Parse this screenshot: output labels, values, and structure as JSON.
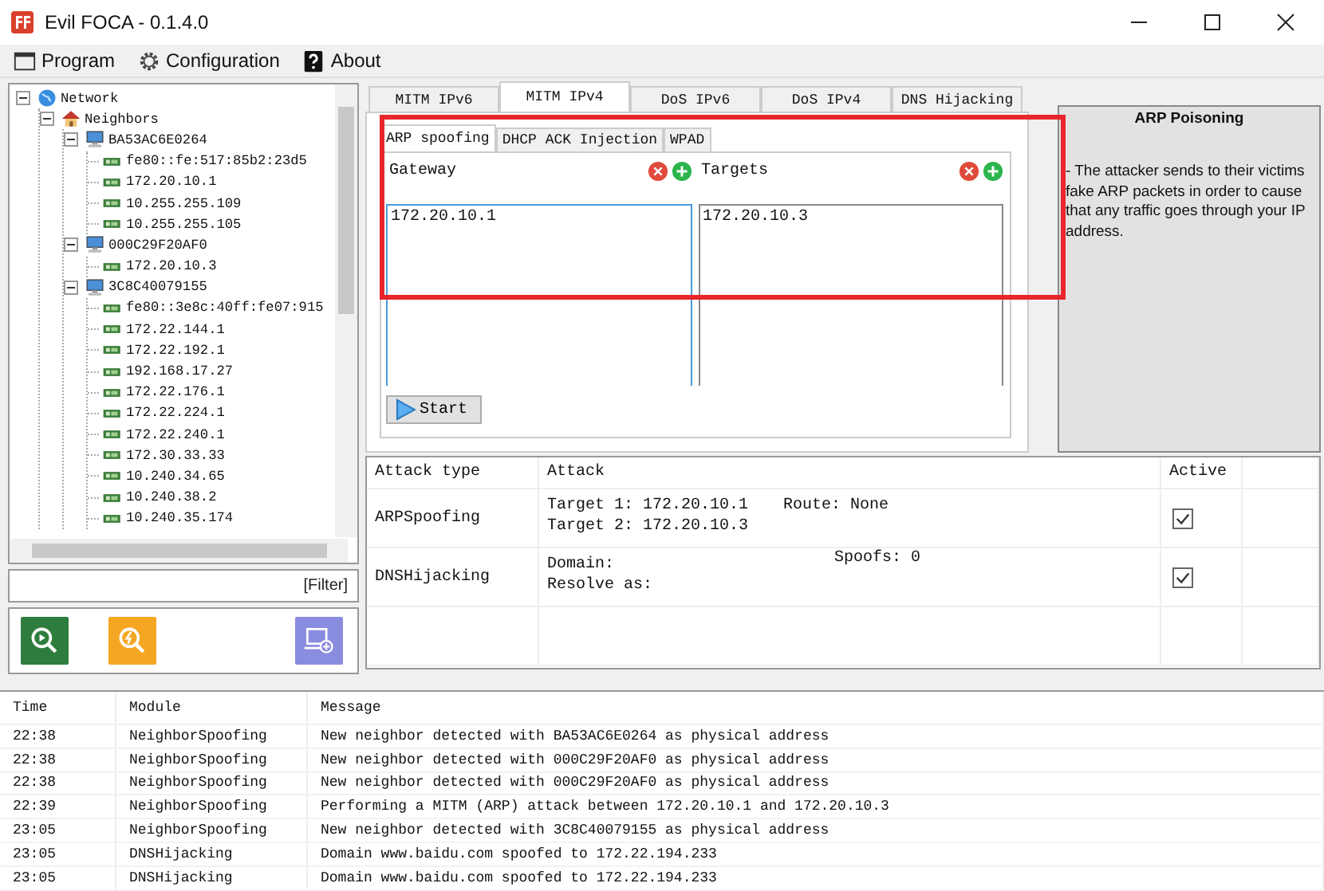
{
  "window": {
    "title": "Evil FOCA - 0.1.4.0"
  },
  "menu": [
    {
      "label": "Program",
      "kind": "window"
    },
    {
      "label": "Configuration",
      "kind": "gear"
    },
    {
      "label": "About",
      "kind": "help"
    }
  ],
  "tree": [
    {
      "label": "Network",
      "kind": "globe",
      "expanded": true,
      "children": [
        {
          "label": "Neighbors",
          "kind": "house",
          "expanded": true,
          "children": [
            {
              "label": "BA53AC6E0264",
              "kind": "computer",
              "expanded": true,
              "children": [
                {
                  "label": "fe80::fe:517:85b2:23d5",
                  "kind": "nic"
                },
                {
                  "label": "172.20.10.1",
                  "kind": "nic"
                },
                {
                  "label": "10.255.255.109",
                  "kind": "nic"
                },
                {
                  "label": "10.255.255.105",
                  "kind": "nic"
                }
              ]
            },
            {
              "label": "000C29F20AF0",
              "kind": "computer",
              "expanded": true,
              "children": [
                {
                  "label": "172.20.10.3",
                  "kind": "nic"
                }
              ]
            },
            {
              "label": "3C8C40079155",
              "kind": "computer",
              "expanded": true,
              "children": [
                {
                  "label": "fe80::3e8c:40ff:fe07:915",
                  "kind": "nic"
                },
                {
                  "label": "172.22.144.1",
                  "kind": "nic"
                },
                {
                  "label": "172.22.192.1",
                  "kind": "nic"
                },
                {
                  "label": "192.168.17.27",
                  "kind": "nic"
                },
                {
                  "label": "172.22.176.1",
                  "kind": "nic"
                },
                {
                  "label": "172.22.224.1",
                  "kind": "nic"
                },
                {
                  "label": "172.22.240.1",
                  "kind": "nic"
                },
                {
                  "label": "172.30.33.33",
                  "kind": "nic"
                },
                {
                  "label": "10.240.34.65",
                  "kind": "nic"
                },
                {
                  "label": "10.240.38.2",
                  "kind": "nic"
                },
                {
                  "label": "10.240.35.174",
                  "kind": "nic"
                }
              ]
            }
          ]
        }
      ]
    }
  ],
  "filter": "[Filter]",
  "tool_buttons": [
    {
      "kind": "scan"
    },
    {
      "kind": "attack-scan"
    },
    {
      "kind": "add-computer"
    }
  ],
  "tabs": [
    {
      "label": "MITM IPv6",
      "selected": false
    },
    {
      "label": "MITM IPv4",
      "selected": true
    },
    {
      "label": "DoS IPv6",
      "selected": false
    },
    {
      "label": "DoS IPv4",
      "selected": false
    },
    {
      "label": "DNS Hijacking",
      "selected": false
    }
  ],
  "subtabs": [
    {
      "label": "ARP spoofing",
      "selected": true
    },
    {
      "label": "DHCP ACK Injection",
      "selected": false
    },
    {
      "label": "WPAD",
      "selected": false
    }
  ],
  "lists": [
    {
      "title": "Gateway",
      "items": [
        "172.20.10.1"
      ],
      "focused": true
    },
    {
      "title": "Targets",
      "items": [
        "172.20.10.3"
      ],
      "focused": false
    }
  ],
  "start_button": "Start",
  "info": {
    "title": "ARP Poisoning",
    "text": "- The attacker sends to their victims fake ARP packets in order to cause that any traffic goes through your IP address."
  },
  "attacks": {
    "columns": [
      "Attack type",
      "Attack",
      "Active"
    ],
    "rows": [
      {
        "type": "ARPSpoofing",
        "lines": [
          "Target 1: 172.20.10.1",
          "Target 2: 172.20.10.3"
        ],
        "extra": "Route: None",
        "active": true
      },
      {
        "type": "DNSHijacking",
        "lines": [
          "Domain:",
          "Resolve as:"
        ],
        "extra": "Spoofs: 0",
        "active": true
      }
    ]
  },
  "log": {
    "columns": [
      "Time",
      "Module",
      "Message"
    ],
    "rows": [
      [
        "22:38",
        "NeighborSpoofing",
        "New neighbor detected with BA53AC6E0264 as physical address"
      ],
      [
        "22:38",
        "NeighborSpoofing",
        "New neighbor detected with 000C29F20AF0 as physical address"
      ],
      [
        "22:38",
        "NeighborSpoofing",
        "New neighbor detected with 000C29F20AF0 as physical address"
      ],
      [
        "22:39",
        "NeighborSpoofing",
        "Performing a MITM (ARP) attack between 172.20.10.1 and 172.20.10.3"
      ],
      [
        "23:05",
        "NeighborSpoofing",
        "New neighbor detected with 3C8C40079155 as physical address"
      ],
      [
        "23:05",
        "DNSHijacking",
        "Domain www.baidu.com spoofed to 172.22.194.233"
      ],
      [
        "23:05",
        "DNSHijacking",
        "Domain www.baidu.com spoofed to 172.22.194.233"
      ]
    ]
  }
}
